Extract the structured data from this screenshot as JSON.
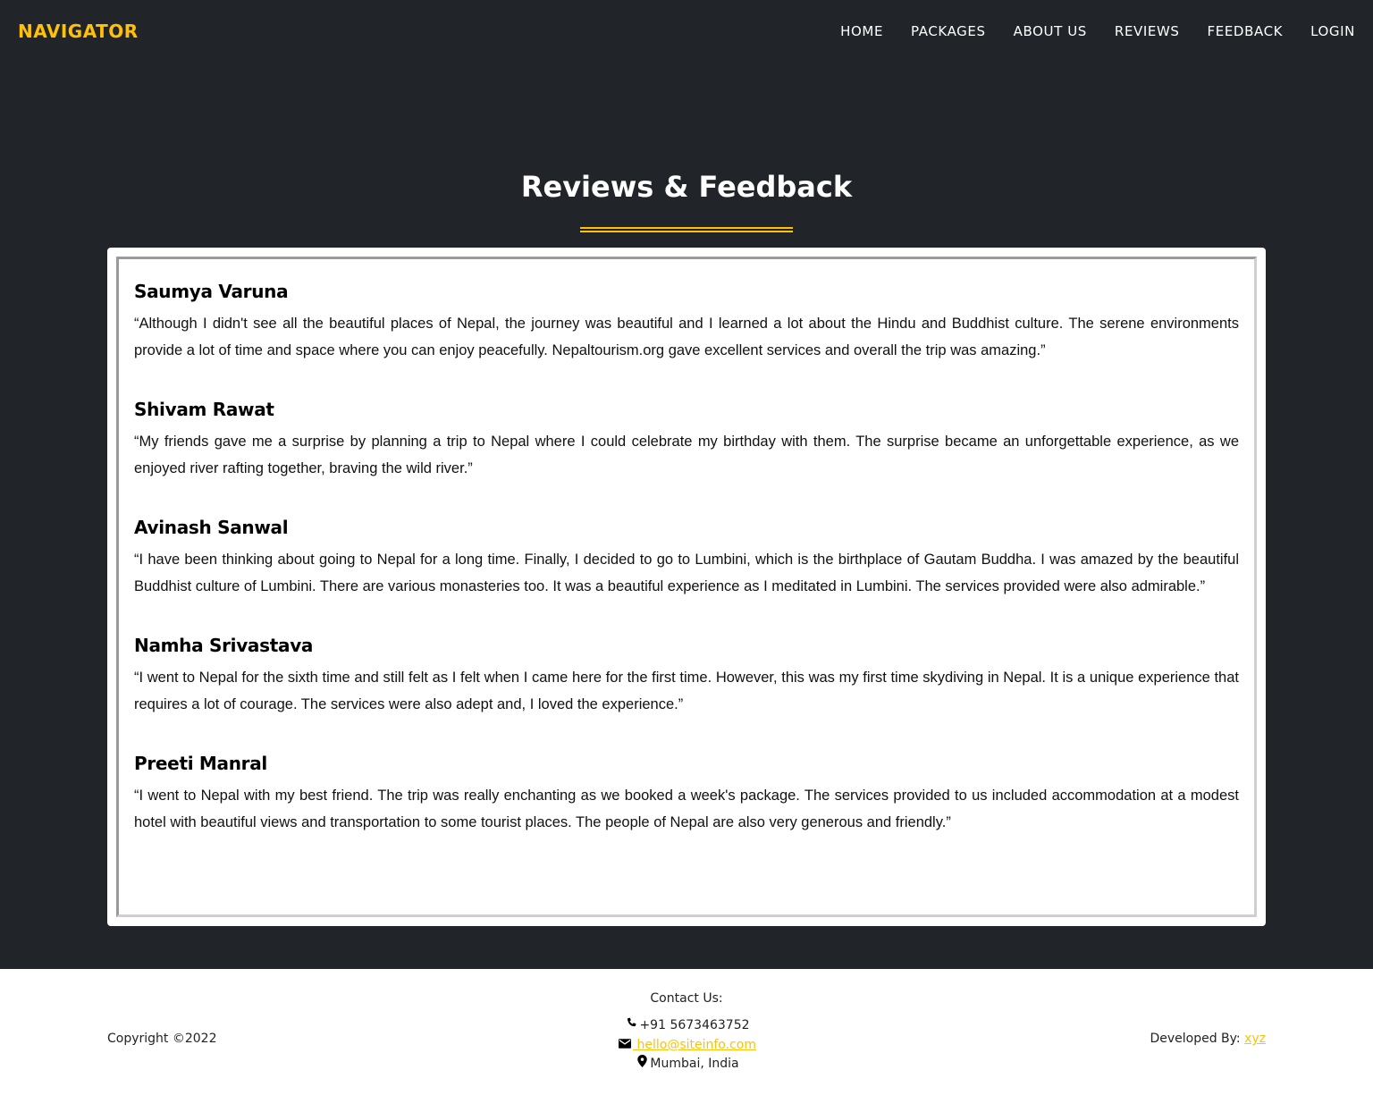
{
  "navbar": {
    "brand": "NAVIGATOR",
    "links": [
      "HOME",
      "PACKAGES",
      "ABOUT US",
      "REVIEWS",
      "FEEDBACK",
      "LOGIN"
    ]
  },
  "page": {
    "heading": "Reviews & Feedback"
  },
  "reviews": [
    {
      "name": "Saumya Varuna",
      "text": "“Although I didn't see all the beautiful places of Nepal, the journey was beautiful and I learned a lot about the Hindu and Buddhist culture. The serene environments provide a lot of time and space where you can enjoy peacefully. Nepaltourism.org gave excellent services and overall the trip was amazing.”"
    },
    {
      "name": "Shivam Rawat",
      "text": "“My friends gave me a surprise by planning a trip to Nepal where I could celebrate my birthday with them. The surprise became an unforgettable experience, as we enjoyed river rafting together, braving the wild river.”"
    },
    {
      "name": "Avinash Sanwal",
      "text": "“I have been thinking about going to Nepal for a long time. Finally, I decided to go to Lumbini, which is the birthplace of Gautam Buddha. I was amazed by the beautiful Buddhist culture of Lumbini. There are various monasteries too. It was a beautiful experience as I meditated in Lumbini. The services provided were also admirable.”"
    },
    {
      "name": "Namha Srivastava",
      "text": "“I went to Nepal for the sixth time and still felt as I felt when I came here for the first time. However, this was my first time skydiving in Nepal. It is a unique experience that requires a lot of courage. The services were also adept and, I loved the experience.”"
    },
    {
      "name": "Preeti Manral",
      "text": "“I went to Nepal with my best friend. The trip was really enchanting as we booked a week's package. The services provided to us included accommodation at a modest hotel with beautiful views and transportation to some tourist places. The people of Nepal are also very generous and friendly.”"
    }
  ],
  "footer": {
    "copyright": "Copyright ©2022",
    "contact_title": "Contact Us:",
    "phone": "+91 5673463752",
    "email": " hello@siteinfo.com",
    "location": "Mumbai, India",
    "developed_label": "Developed By: ",
    "developer": "xyz",
    "icons": {
      "phone": "phone-icon",
      "email": "envelope-icon",
      "location": "map-marker-icon"
    }
  },
  "colors": {
    "accent": "#ffc107",
    "dark_bg": "#212529"
  }
}
